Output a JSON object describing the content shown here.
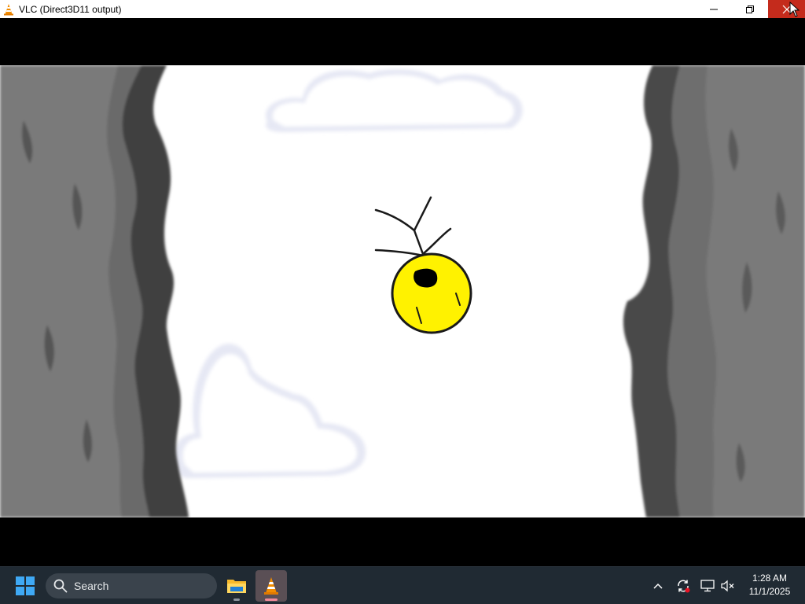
{
  "window": {
    "title": "VLC (Direct3D11 output)",
    "icon": "vlc-cone-icon",
    "controls": [
      "minimize-icon",
      "restore-icon",
      "close-icon"
    ]
  },
  "video": {
    "scene": "cartoon cave with clouds and a yellow creature falling",
    "colors": {
      "sky": "#ffffff",
      "rock_dark": "#5a5a5a",
      "rock_light": "#777777",
      "creature": "#fff200",
      "cloud": "#eef0f8"
    }
  },
  "taskbar": {
    "search_placeholder": "Search",
    "apps": [
      "file-explorer-icon",
      "vlc-icon"
    ],
    "tray": [
      "chevron-up-icon",
      "update-icon",
      "network-icon",
      "volume-muted-icon"
    ],
    "clock": {
      "time": "1:28 AM",
      "date": "11/1/2025"
    },
    "colors": {
      "background": "#202a33",
      "search_bg": "#3a434c"
    }
  }
}
